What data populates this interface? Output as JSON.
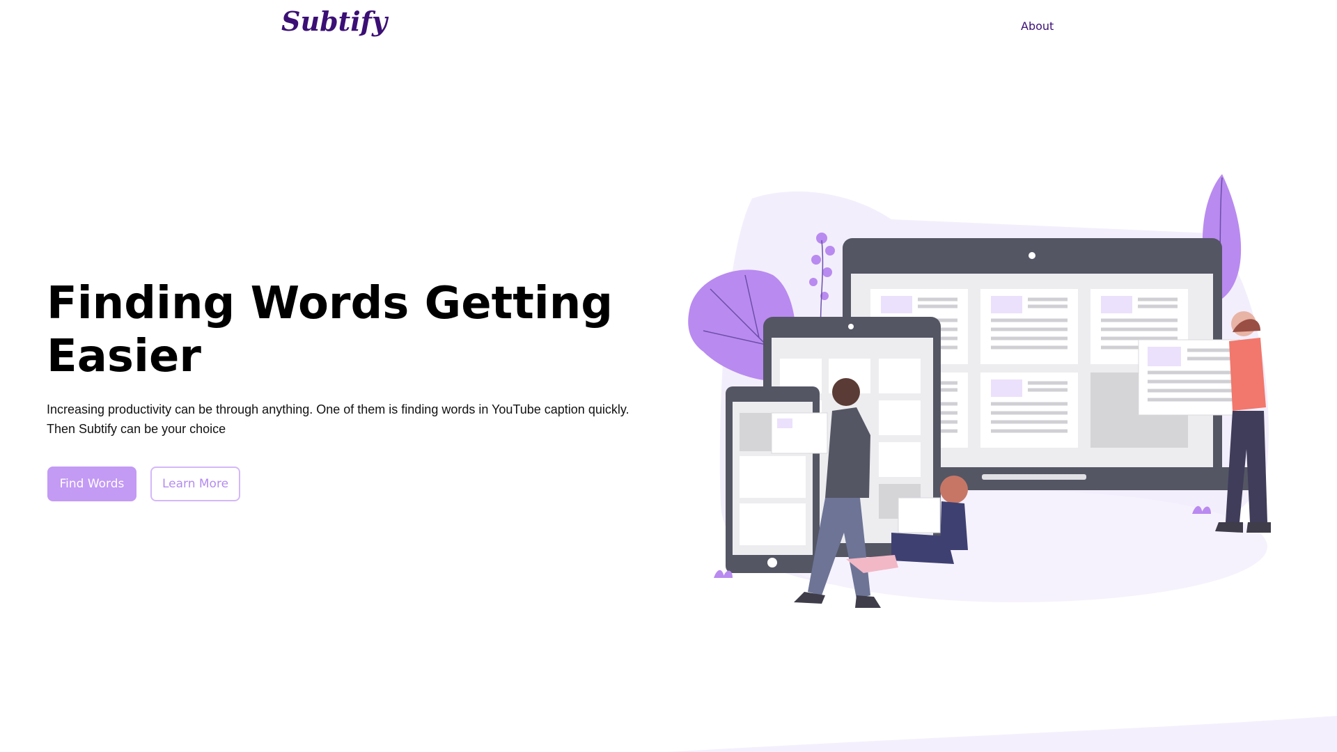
{
  "brand": "Subtify",
  "nav": {
    "about_label": "About"
  },
  "hero": {
    "title_line1": "Finding Words Getting",
    "title_line2": "Easier",
    "description": "Increasing productivity can be through anything. One of them is finding words in YouTube caption quickly. Then Subtify can be your choice",
    "primary_button": "Find Words",
    "secondary_button": "Learn More"
  },
  "colors": {
    "brand": "#3b0f75",
    "primary_button": "#c39af4",
    "outline_button_text": "#b48cef",
    "illustration_accent": "#b98af0"
  },
  "illustration": {
    "icon": "devices-reading-people-illustration"
  }
}
